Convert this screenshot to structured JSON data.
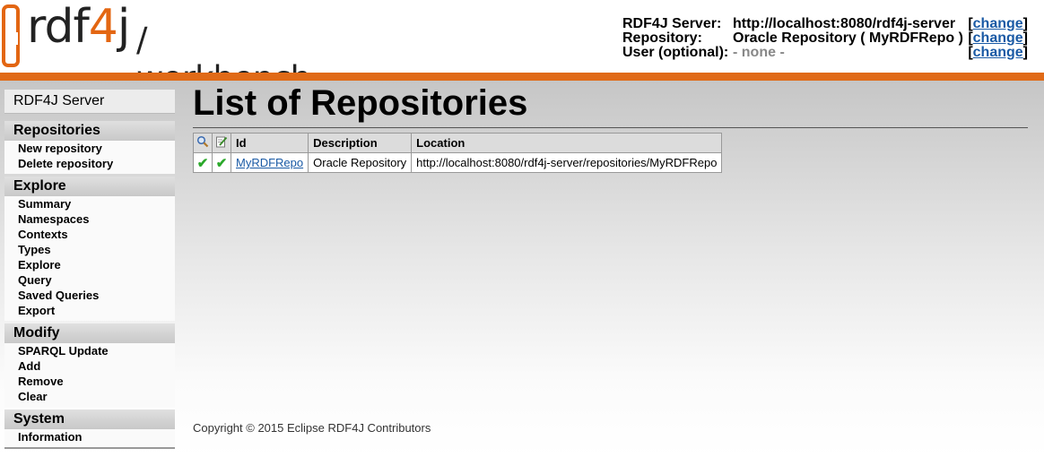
{
  "header": {
    "logo_text": "rdf",
    "logo_four": "4",
    "logo_j": "j",
    "logo_subtitle": "/ workbench",
    "server_label": "RDF4J Server:",
    "server_value": "http://localhost:8080/rdf4j-server",
    "repository_label": "Repository:",
    "repository_value": "Oracle Repository ( MyRDFRepo )",
    "user_label": "User (optional):",
    "user_value": "- none -",
    "change_label": "change"
  },
  "sidebar": {
    "server": "RDF4J Server",
    "sections": [
      {
        "title": "Repositories",
        "items": [
          "New repository",
          "Delete repository"
        ]
      },
      {
        "title": "Explore",
        "items": [
          "Summary",
          "Namespaces",
          "Contexts",
          "Types",
          "Explore",
          "Query",
          "Saved Queries",
          "Export"
        ]
      },
      {
        "title": "Modify",
        "items": [
          "SPARQL Update",
          "Add",
          "Remove",
          "Clear"
        ]
      },
      {
        "title": "System",
        "items": [
          "Information"
        ]
      }
    ]
  },
  "main": {
    "title": "List of Repositories",
    "table": {
      "headers": [
        "Id",
        "Description",
        "Location"
      ],
      "icons": [
        "search-icon",
        "edit-icon"
      ],
      "rows": [
        {
          "id": "MyRDFRepo",
          "description": "Oracle Repository",
          "location": "http://localhost:8080/rdf4j-server/repositories/MyRDFRepo",
          "readable": "✔",
          "writable": "✔"
        }
      ]
    }
  },
  "footer": "Copyright © 2015 Eclipse RDF4J Contributors",
  "colors": {
    "accent": "#e06a17",
    "link": "#1a5aa5",
    "check": "#2aa82a"
  }
}
